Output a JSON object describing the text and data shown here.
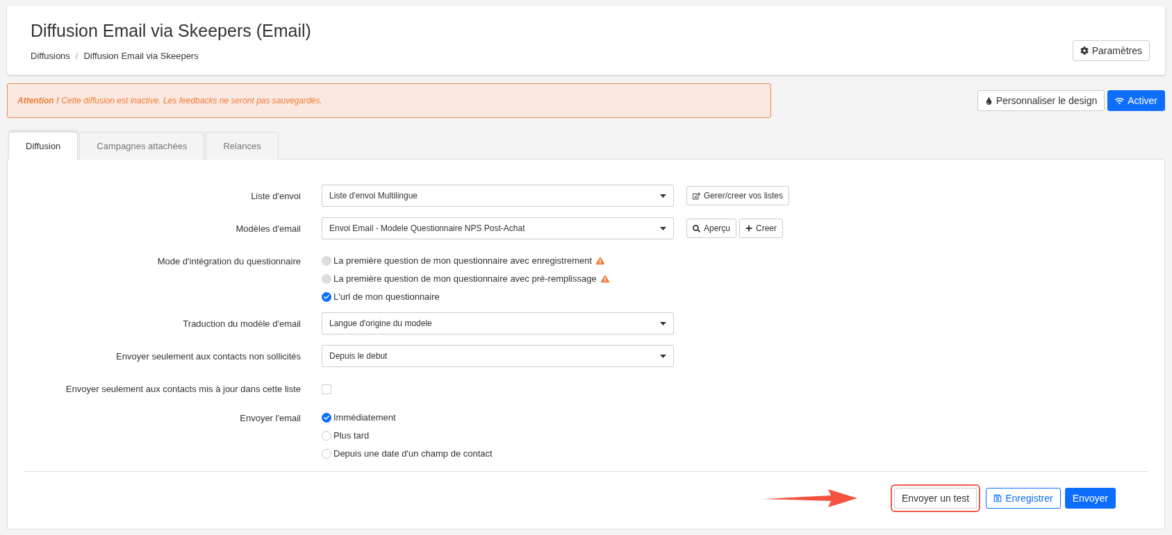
{
  "header": {
    "title": "Diffusion Email via Skeepers (Email)",
    "breadcrumb": [
      "Diffusions",
      "Diffusion Email via Skeepers"
    ],
    "breadcrumb_separator": "/",
    "settings_button": "Paramètres"
  },
  "alert": {
    "strong": "Attention !",
    "message": "Cette diffusion est inactive. Les feedbacks ne seront pas sauvegardés."
  },
  "actions": [
    {
      "kind": "design",
      "label": "Personnaliser le design"
    },
    {
      "kind": "activate",
      "label": "Activer"
    }
  ],
  "tabs": [
    {
      "label": "Diffusion",
      "selected": true
    },
    {
      "label": "Campagnes attachées",
      "selected": false
    },
    {
      "label": "Relances",
      "selected": false
    }
  ],
  "form": [
    {
      "kind": "select",
      "label": "Liste d'envoi",
      "value": "Liste d'envoi Multilingue",
      "buttons": [
        {
          "kind": "edit",
          "label": "Gerer/creer vos listes"
        }
      ]
    },
    {
      "kind": "select",
      "label": "Modèles d'email",
      "value": "Envoi Email - Modele Questionnaire NPS Post-Achat",
      "buttons": [
        {
          "kind": "preview",
          "label": "Aperçu"
        },
        {
          "kind": "create",
          "label": "Creer"
        }
      ]
    },
    {
      "kind": "radio",
      "label": "Mode d'intégration du questionnaire",
      "options": [
        {
          "label": "La première question de mon questionnaire avec enregistrement",
          "selected": false,
          "disabled": true,
          "warning": true
        },
        {
          "label": "La première question de mon questionnaire avec pré-remplissage",
          "selected": false,
          "disabled": true,
          "warning": true
        },
        {
          "label": "L'url de mon questionnaire",
          "selected": true,
          "disabled": false,
          "warning": false
        }
      ]
    },
    {
      "kind": "select",
      "label": "Traduction du modèle d'email",
      "value": "Langue d'origine du modele"
    },
    {
      "kind": "select",
      "label": "Envoyer seulement aux contacts non sollicités",
      "value": "Depuis le debut"
    },
    {
      "kind": "checkbox",
      "label": "Envoyer seulement aux contacts mis à jour dans cette liste",
      "checked": false
    },
    {
      "kind": "radio",
      "label": "Envoyer l'email",
      "options": [
        {
          "label": "Immédiatement",
          "selected": true,
          "disabled": false,
          "warning": false
        },
        {
          "label": "Plus tard",
          "selected": false,
          "disabled": false,
          "warning": false
        },
        {
          "label": "Depuis une date d'un champ de contact",
          "selected": false,
          "disabled": false,
          "warning": false
        }
      ]
    }
  ],
  "footer_buttons": [
    {
      "kind": "default",
      "label": "Envoyer un test",
      "highlighted": true
    },
    {
      "kind": "outline",
      "label": "Enregistrer",
      "highlighted": false
    },
    {
      "kind": "primary",
      "label": "Envoyer",
      "highlighted": false
    }
  ]
}
